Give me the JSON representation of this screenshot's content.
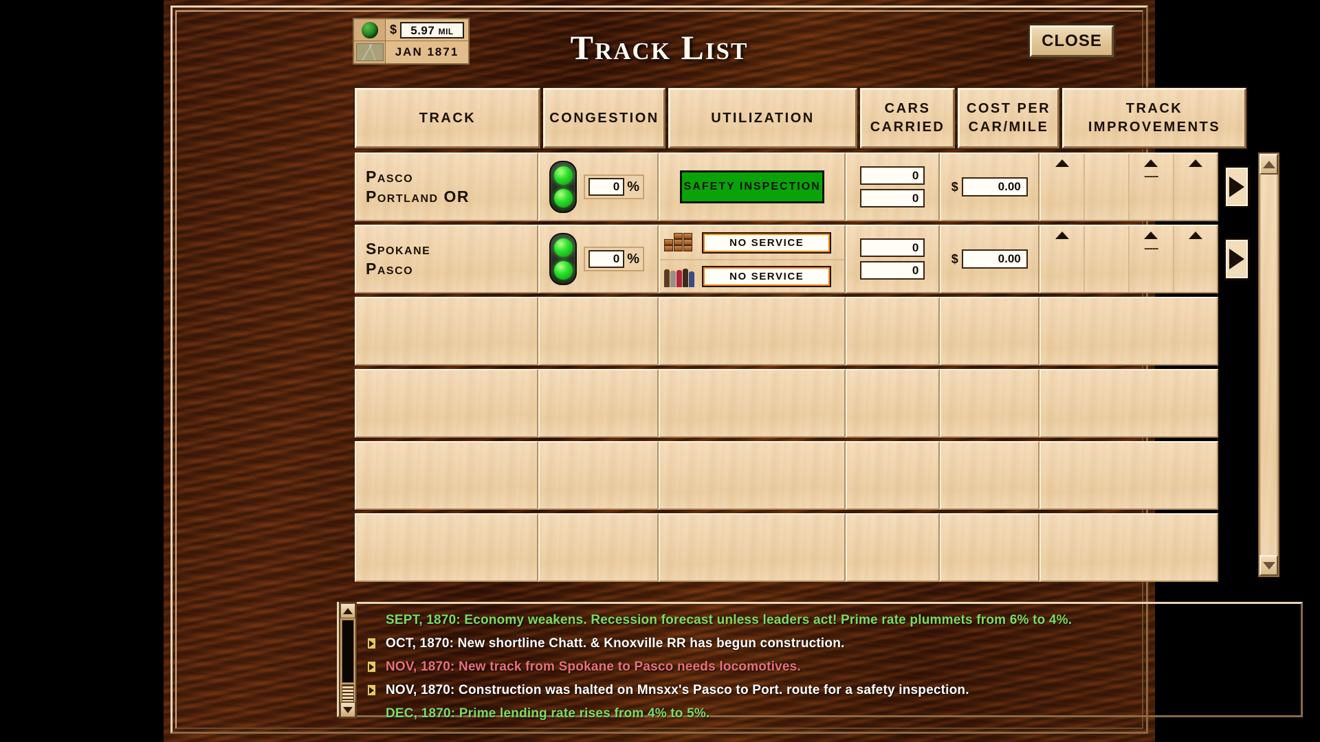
{
  "window": {
    "title": "Track List",
    "close_label": "CLOSE"
  },
  "status": {
    "money_icon": "money-dot-icon",
    "map_icon": "map-thumbnail-icon",
    "currency_symbol": "$",
    "money_value": "5.97",
    "money_unit": "MIL",
    "date": "JAN  1871"
  },
  "table": {
    "headers": {
      "track": "TRACK",
      "congestion": "CONGESTION",
      "utilization": "UTILIZATION",
      "cars_carried": "CARS CARRIED",
      "cost_per_car_mile": "COST PER CAR/MILE",
      "track_improvements": "TRACK IMPROVEMENTS"
    },
    "rows": [
      {
        "track_from": "Pasco",
        "track_to": "Portland  OR",
        "congestion_pct": "0",
        "congestion_unit": "%",
        "signal_state": "green",
        "utilization_mode": "banner",
        "utilization_banner": "SAFETY INSPECTION",
        "utilization_banner_color": "#09a309",
        "cars_carried_1": "0",
        "cars_carried_2": "0",
        "cost_symbol": "$",
        "cost_value": "0.00",
        "improvements": [
          "▲",
          "",
          "▲",
          "▲"
        ],
        "improvement_dashes": "-----",
        "detail_button": "detail-arrow"
      },
      {
        "track_from": "Spokane",
        "track_to": "Pasco",
        "congestion_pct": "0",
        "congestion_unit": "%",
        "signal_state": "green",
        "utilization_mode": "dual",
        "utilization_freight": "NO SERVICE",
        "utilization_passenger": "NO SERVICE",
        "utilization_banner_color": "#f5880e",
        "cars_carried_1": "0",
        "cars_carried_2": "0",
        "cost_symbol": "$",
        "cost_value": "0.00",
        "improvements": [
          "▲",
          "",
          "▲",
          "▲"
        ],
        "improvement_dashes": "-----",
        "detail_button": "detail-arrow"
      },
      {
        "empty": true
      },
      {
        "empty": true
      },
      {
        "empty": true
      },
      {
        "empty": true
      }
    ]
  },
  "log": {
    "lines": [
      {
        "text": "SEPT, 1870: Economy weakens.  Recession forecast unless leaders act! Prime rate plummets from 6% to 4%.",
        "color": "#7ddc62",
        "bullet": false
      },
      {
        "text": "OCT, 1870: New shortline Chatt. & Knoxville RR has begun construction.",
        "color": "#ffffff",
        "bullet": true
      },
      {
        "text": "NOV, 1870: New track from Spokane to Pasco needs locomotives.",
        "color": "#e8707c",
        "bullet": true
      },
      {
        "text": "NOV, 1870: Construction was halted on Mnsxx's Pasco to Port. route for a safety inspection.",
        "color": "#ffffff",
        "bullet": true
      },
      {
        "text": "DEC, 1870: Prime lending rate rises from 4% to 5%.",
        "color": "#7ddc62",
        "bullet": false
      }
    ]
  },
  "colors": {
    "wood_dark": "#5a2710",
    "wood_light": "#f1d6b0",
    "green_banner": "#09a309",
    "orange_banner": "#f5880e",
    "signal_green": "#2ce22c"
  }
}
